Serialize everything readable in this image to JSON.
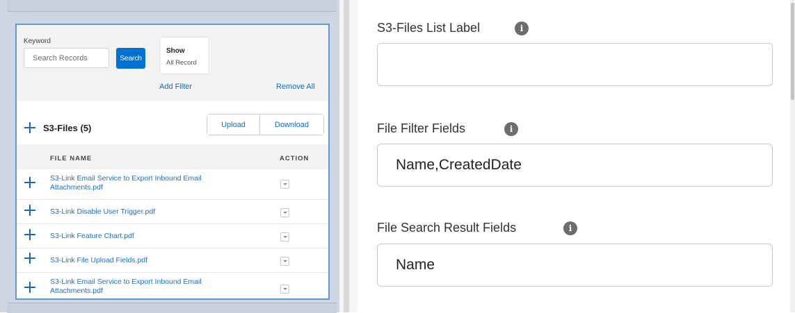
{
  "preview": {
    "keyword_label": "Keyword",
    "search_placeholder": "Search Records",
    "search_button": "Search",
    "show_title": "Show",
    "show_value": "All Record",
    "add_filter": "Add Filter",
    "remove_all": "Remove All",
    "files_title": "S3-Files (5)",
    "upload_button": "Upload",
    "download_button": "Download",
    "columns": [
      "FILE NAME",
      "ACTION"
    ],
    "rows": [
      {
        "name": "S3-Link Email Service to Export Inbound Email Attachments.pdf"
      },
      {
        "name": "S3-Link Disable User Trigger.pdf"
      },
      {
        "name": "S3-Link Feature Chart.pdf"
      },
      {
        "name": "S3-Link File Upload Fields.pdf"
      },
      {
        "name": "S3-Link Email Service to Export Inbound Email Attachments.pdf"
      }
    ]
  },
  "form": {
    "list_label": {
      "label": "S3-Files List Label",
      "value": ""
    },
    "filter_fields": {
      "label": "File Filter Fields",
      "value": "Name,CreatedDate"
    },
    "result_fields": {
      "label": "File Search Result Fields",
      "value": "Name"
    },
    "info_glyph": "i"
  },
  "colors": {
    "brand_blue": "#0070d2",
    "link_blue": "#1b6fc9",
    "frame_border": "#5b9bd5",
    "info_icon": "#6d6d6d"
  }
}
